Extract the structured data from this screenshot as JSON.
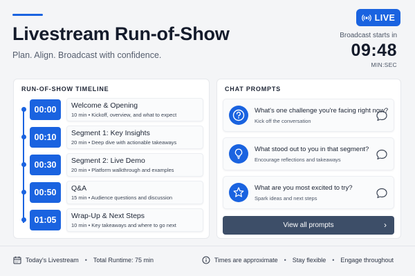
{
  "header": {
    "title": "Livestream Run-of-Show",
    "subtitle": "Plan. Align. Broadcast with confidence.",
    "live_label": "LIVE",
    "countdown_label": "Broadcast starts in",
    "countdown_time": "09:48",
    "countdown_unit": "MIN:SEC"
  },
  "timeline": {
    "heading": "RUN-OF-SHOW TIMELINE",
    "items": [
      {
        "time": "00:00",
        "title": "Welcome & Opening",
        "desc": "10 min  •  Kickoff, overview, and what to expect"
      },
      {
        "time": "00:10",
        "title": "Segment 1: Key Insights",
        "desc": "20 min  •  Deep dive with actionable takeaways"
      },
      {
        "time": "00:30",
        "title": "Segment 2: Live Demo",
        "desc": "20 min  •  Platform walkthrough and examples"
      },
      {
        "time": "00:50",
        "title": "Q&A",
        "desc": "15 min  •  Audience questions and discussion"
      },
      {
        "time": "01:05",
        "title": "Wrap-Up & Next Steps",
        "desc": "10 min  •  Key takeaways and where to go next"
      }
    ]
  },
  "prompts": {
    "heading": "CHAT PROMPTS",
    "items": [
      {
        "icon": "question-icon",
        "title": "What's one challenge you're facing right now?",
        "sub": "Kick off the conversation"
      },
      {
        "icon": "lightbulb-icon",
        "title": "What stood out to you in that segment?",
        "sub": "Encourage reflections and takeaways"
      },
      {
        "icon": "star-icon",
        "title": "What are you most excited to try?",
        "sub": "Spark ideas and next steps"
      }
    ],
    "view_all_label": "View all prompts"
  },
  "footer": {
    "left_label": "Today's Livestream",
    "runtime": "Total Runtime: 75 min",
    "note_1": "Times are approximate",
    "note_2": "Stay flexible",
    "note_3": "Engage throughout"
  },
  "colors": {
    "accent": "#1a63e0",
    "button_dark": "#3d4e68",
    "page_bg": "#f4f5f7"
  }
}
